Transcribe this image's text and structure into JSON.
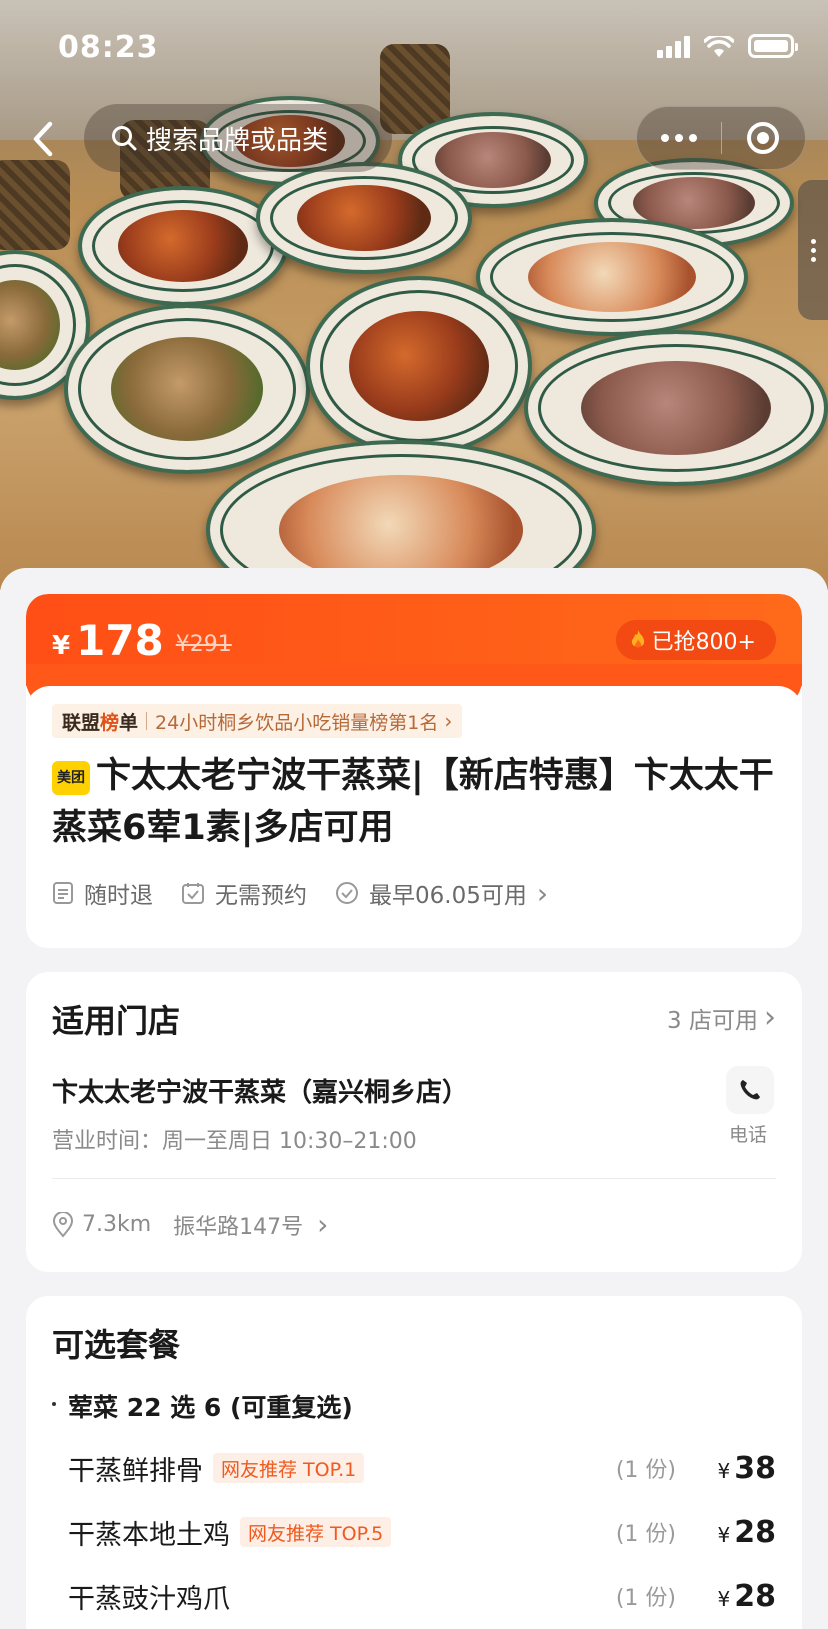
{
  "status_bar": {
    "time": "08:23"
  },
  "nav": {
    "search_placeholder": "搜索品牌或品类"
  },
  "deal": {
    "currency": "¥",
    "price": "178",
    "original_price": "¥291",
    "sold": "已抢800+",
    "rank_brand_a": "联盟",
    "rank_brand_b": "榜",
    "rank_brand_c": "单",
    "rank_text": "24小时桐乡饮品小吃销量榜第1名",
    "platform_badge": "美团",
    "title": "卞太太老宁波干蒸菜|【新店特惠】卞太太干蒸菜6荤1素|多店可用",
    "features": [
      "随时退",
      "无需预约",
      "最早06.05可用"
    ]
  },
  "store": {
    "section_title": "适用门店",
    "count_text": "3 店可用",
    "name": "卞太太老宁波干蒸菜（嘉兴桐乡店）",
    "hours": "营业时间：周一至周日 10:30–21:00",
    "phone_label": "电话",
    "distance": "7.3km",
    "address": "振华路147号"
  },
  "packages": {
    "section_title": "可选套餐",
    "group_title": "荤菜 22 选 6 (可重复选)",
    "currency": "¥",
    "items": [
      {
        "name": "干蒸鲜排骨",
        "tag": "网友推荐 TOP.1",
        "qty": "(1 份)",
        "price": "38"
      },
      {
        "name": "干蒸本地土鸡",
        "tag": "网友推荐 TOP.5",
        "qty": "(1 份)",
        "price": "28"
      },
      {
        "name": "干蒸豉汁鸡爪",
        "tag": "",
        "qty": "(1 份)",
        "price": "28"
      }
    ]
  },
  "colors": {
    "accent": "#ff5818",
    "tag_bg": "#fdeee6",
    "tag_text": "#f05a1e"
  }
}
